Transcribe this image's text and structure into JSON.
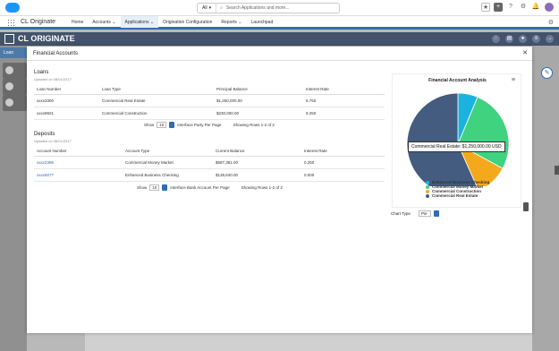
{
  "topbar": {
    "search_scope": "All",
    "search_placeholder": "Search Applications and more..."
  },
  "nav": {
    "app_name": "CL Originate",
    "items": [
      {
        "label": "Home",
        "has_menu": false
      },
      {
        "label": "Accounts",
        "has_menu": true
      },
      {
        "label": "Applications",
        "has_menu": true
      },
      {
        "label": "Origination Configuration",
        "has_menu": false
      },
      {
        "label": "Reports",
        "has_menu": true
      },
      {
        "label": "Launchpad",
        "has_menu": false
      }
    ]
  },
  "brand": {
    "title": "CL ORIGINATE"
  },
  "sidebar": {
    "loan_label": "Loan"
  },
  "modal": {
    "title": "Financial Accounts",
    "loans": {
      "title": "Loans",
      "subtitle": "Updated on 08/01/2017",
      "columns": [
        "Loan Number",
        "Loan Type",
        "Principal Balance",
        "Interest Rate"
      ],
      "rows": [
        [
          "xxxx3300",
          "Commercial Real Estate",
          "$1,250,000.00",
          "8.750"
        ],
        [
          "xxxx9921",
          "Commercial Construction",
          "$230,000.00",
          "9.250"
        ]
      ],
      "pager": {
        "show": "Show",
        "per_page_value": "10",
        "per_page_label": "Interface Party Per Page",
        "showing": "Showing Rows 1-2 of 2"
      }
    },
    "deposits": {
      "title": "Deposits",
      "subtitle": "Updated on 08/01/2017",
      "columns": [
        "Account Number",
        "Account Type",
        "Current Balance",
        "Interest Rate"
      ],
      "rows": [
        [
          "xxxx2396",
          "Commercial Money Market",
          "$587,381.00",
          "0.250"
        ],
        [
          "xxxx5077",
          "Enhanced Business Checking",
          "$138,840.00",
          "0.000"
        ]
      ],
      "pager": {
        "show": "Show",
        "per_page_value": "10",
        "per_page_label": "Interface Bank Account Per Page",
        "showing": "Showing Rows 1-2 of 2"
      }
    }
  },
  "chart_data": {
    "type": "pie",
    "title": "Financial Account Analysis",
    "categories": [
      "Enhanced Business Checking",
      "Commercial Money Market",
      "Commercial Construction",
      "Commercial Real Estate"
    ],
    "values": [
      138840,
      587381,
      230000,
      1250000
    ],
    "colors": [
      "#1ab3dd",
      "#3fd37f",
      "#f4a91d",
      "#435c7f"
    ],
    "tooltip": "Commercial Real Estate: $1,250,000.00 USD",
    "legend_position": "bottom"
  },
  "chart_type": {
    "label": "Chart Type",
    "value": "Pie"
  }
}
